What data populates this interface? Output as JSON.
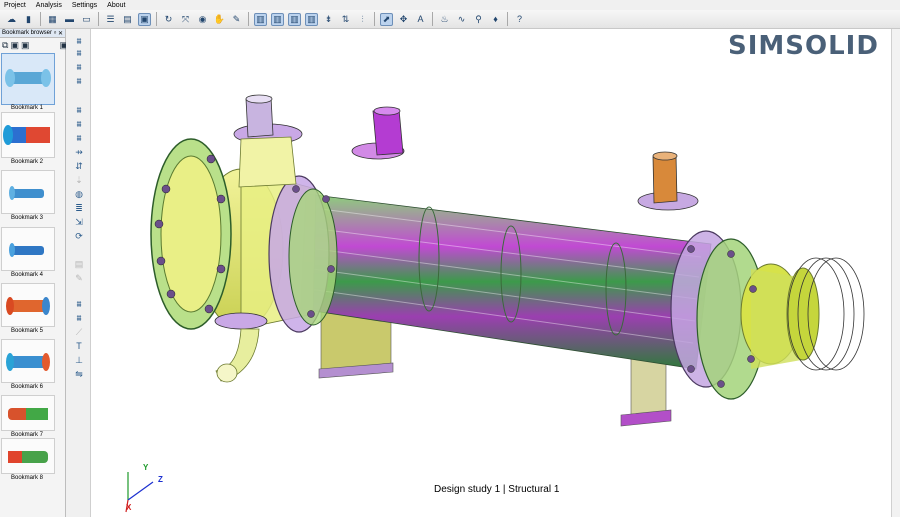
{
  "menu": [
    "Project",
    "Analysis",
    "Settings",
    "About"
  ],
  "toolbar_icons": [
    "cloud-icon",
    "save-icon",
    "grid-icon",
    "folder-icon",
    "image-icon",
    "list-icon",
    "table-icon",
    "window-icon",
    "rotate-icon",
    "zoom-icon",
    "eye-icon",
    "hand-icon",
    "tool-icon",
    "view-iso-icon",
    "view-front-icon",
    "view-side-icon",
    "view-top-icon",
    "pin-icon",
    "arrows-icon",
    "filter-icon",
    "select-icon",
    "move-icon",
    "annotate-icon",
    "flow-icon",
    "wave-icon",
    "probe-icon",
    "drop-icon",
    "help-icon"
  ],
  "sidebar": {
    "title": "Bookmark browser",
    "bookmarks": [
      {
        "label": "Bookmark 1"
      },
      {
        "label": "Bookmark 2"
      },
      {
        "label": "Bookmark 3"
      },
      {
        "label": "Bookmark 4"
      },
      {
        "label": "Bookmark 5"
      },
      {
        "label": "Bookmark 6"
      },
      {
        "label": "Bookmark 7"
      },
      {
        "label": "Bookmark 8"
      }
    ]
  },
  "logo": "SIMSOLID",
  "status": "Design study 1 | Structural  1",
  "axes": {
    "y": "Y",
    "z": "Z",
    "x": "X"
  },
  "colors": {
    "accent": "#4a6078",
    "selection": "#bcd3ee"
  }
}
